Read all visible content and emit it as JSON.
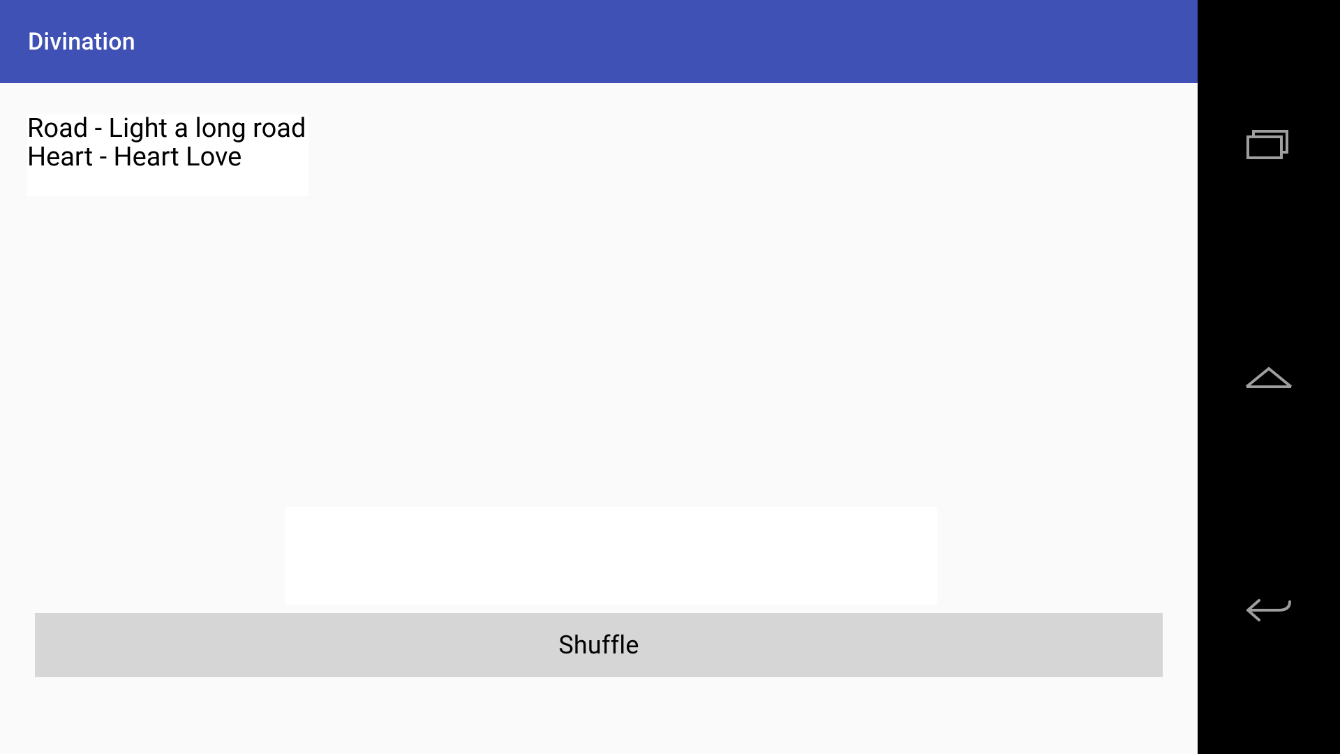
{
  "appBar": {
    "title": "Divination"
  },
  "results": {
    "line1": "Road - Light a long road",
    "line2": "Heart - Heart Love"
  },
  "buttons": {
    "shuffle": "Shuffle"
  },
  "nav": {
    "recent": "recent-apps",
    "home": "home",
    "back": "back"
  },
  "colors": {
    "primary": "#3f51b5",
    "background": "#fafafa",
    "buttonBg": "#d6d6d6"
  }
}
